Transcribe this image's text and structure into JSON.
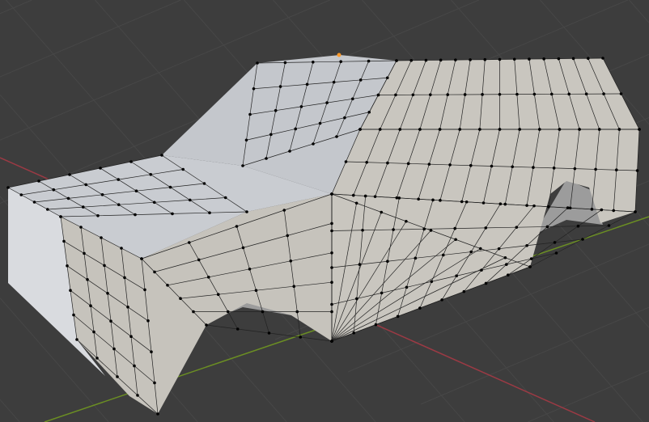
{
  "viewport": {
    "mode": "edit-mode",
    "object": "car-mesh",
    "colors": {
      "background": "#3d3d3d",
      "grid": "#474747",
      "x_axis": "#9b3a44",
      "y_axis": "#6b8e23",
      "face_light": "#d9dbdf",
      "face_top": "#c9ccd1",
      "face_side": "#c9c6bf",
      "wire": "#1a1a1a",
      "vertex": "#000000",
      "active_vertex": "#ff9a2a"
    }
  }
}
